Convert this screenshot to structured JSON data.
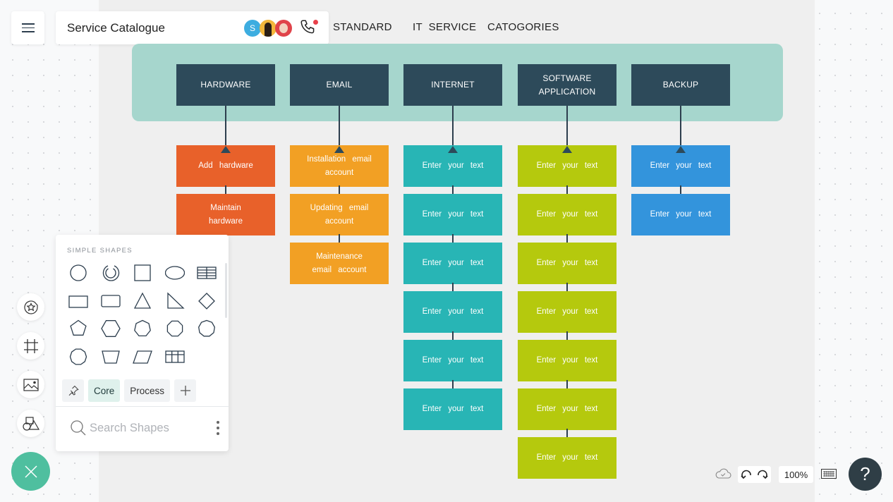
{
  "app": {
    "document_title": "Service Catalogue",
    "menu_icon": "hamburger-menu-icon",
    "collaborators": [
      {
        "initial": "S",
        "color": "#3dade0"
      },
      {
        "initial": "",
        "color": "#f3b73c"
      },
      {
        "initial": "",
        "color": "#e0434a"
      }
    ],
    "call_icon": "phone-call-icon"
  },
  "canvas_heading": {
    "words": [
      "STANDARD",
      "IT  SERVICE",
      "CATOGORIES"
    ]
  },
  "diagram": {
    "band_color": "#a6d6cd",
    "category_color": "#2d4a5a",
    "columns": [
      {
        "title": "HARDWARE",
        "color": "#e8612a",
        "items": [
          "Add   hardware",
          "Maintain hardware"
        ]
      },
      {
        "title": "EMAIL",
        "color": "#f2a024",
        "items": [
          "Installation   email account",
          "Updating   email account",
          "Maintenance email   account"
        ]
      },
      {
        "title": "INTERNET",
        "color": "#28b5b5",
        "items": [
          "Enter your text",
          "Enter your text",
          "Enter your text",
          "Enter your text",
          "Enter your text",
          "Enter your text"
        ]
      },
      {
        "title": "SOFTWARE\nAPPLICATION",
        "color": "#b5c90d",
        "items": [
          "Enter your text",
          "Enter your text",
          "Enter your text",
          "Enter your text",
          "Enter your text",
          "Enter your text",
          "Enter your text"
        ]
      },
      {
        "title": "BACKUP",
        "color": "#3394dc",
        "items": [
          "Enter your text",
          "Enter your text"
        ]
      }
    ]
  },
  "shapes_panel": {
    "section_label": "SIMPLE SHAPES",
    "shapes": [
      "circle",
      "partial-ring",
      "square",
      "ellipse",
      "table-striped",
      "rectangle",
      "rounded-rectangle",
      "triangle",
      "right-triangle",
      "diamond",
      "pentagon",
      "hexagon",
      "heptagon",
      "octagon",
      "nonagon",
      "decagon",
      "trapezoid",
      "parallelogram",
      "table-grid"
    ],
    "tabs": [
      {
        "label": "",
        "icon": "pin-icon"
      },
      {
        "label": "Core",
        "active": true
      },
      {
        "label": "Process",
        "active": false
      },
      {
        "label": "",
        "icon": "plus-icon"
      }
    ],
    "search_placeholder": "Search Shapes"
  },
  "left_toolbar": [
    {
      "name": "sticker-star",
      "icon": "star-sticker-icon"
    },
    {
      "name": "frame",
      "icon": "frame-icon"
    },
    {
      "name": "image",
      "icon": "image-icon"
    },
    {
      "name": "shapes",
      "icon": "shapes-icon"
    }
  ],
  "bottom_bar": {
    "zoom_level": "100%",
    "help_label": "?",
    "cloud_status": "saved"
  }
}
